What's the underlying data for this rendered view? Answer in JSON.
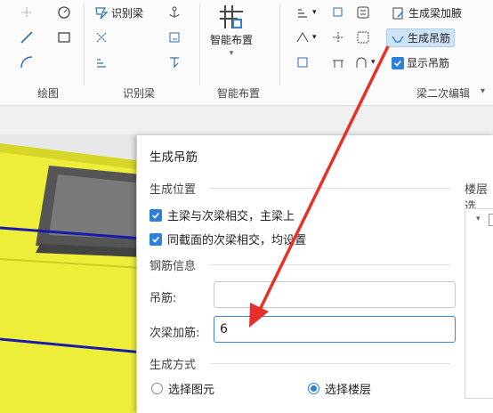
{
  "ribbon": {
    "groups": {
      "draw": "绘图",
      "identify": "识别梁",
      "smart": "智能布置",
      "second_edit": "梁二次编辑"
    },
    "identify_beam_btn": "识别梁",
    "smart_layout_btn": "智能布置",
    "gen_haunch_btn": "生成梁加腋",
    "gen_hanger_btn": "生成吊筋",
    "show_hanger_chk": "显示吊筋",
    "accent": "#2d7fd8"
  },
  "dialog": {
    "title": "生成吊筋",
    "section_position": "生成位置",
    "floor_label": "楼层选",
    "opt1": "主梁与次梁相交，主梁上",
    "opt2": "同截面的次梁相交，均设置",
    "section_rebar": "钢筋信息",
    "hanger_label": "吊筋:",
    "hanger_value": "",
    "secondary_label": "次梁加筋:",
    "secondary_value": "6",
    "section_mode": "生成方式",
    "radio1": "选择图元",
    "radio2": "选择楼层",
    "radio_selected": "选择楼层"
  }
}
